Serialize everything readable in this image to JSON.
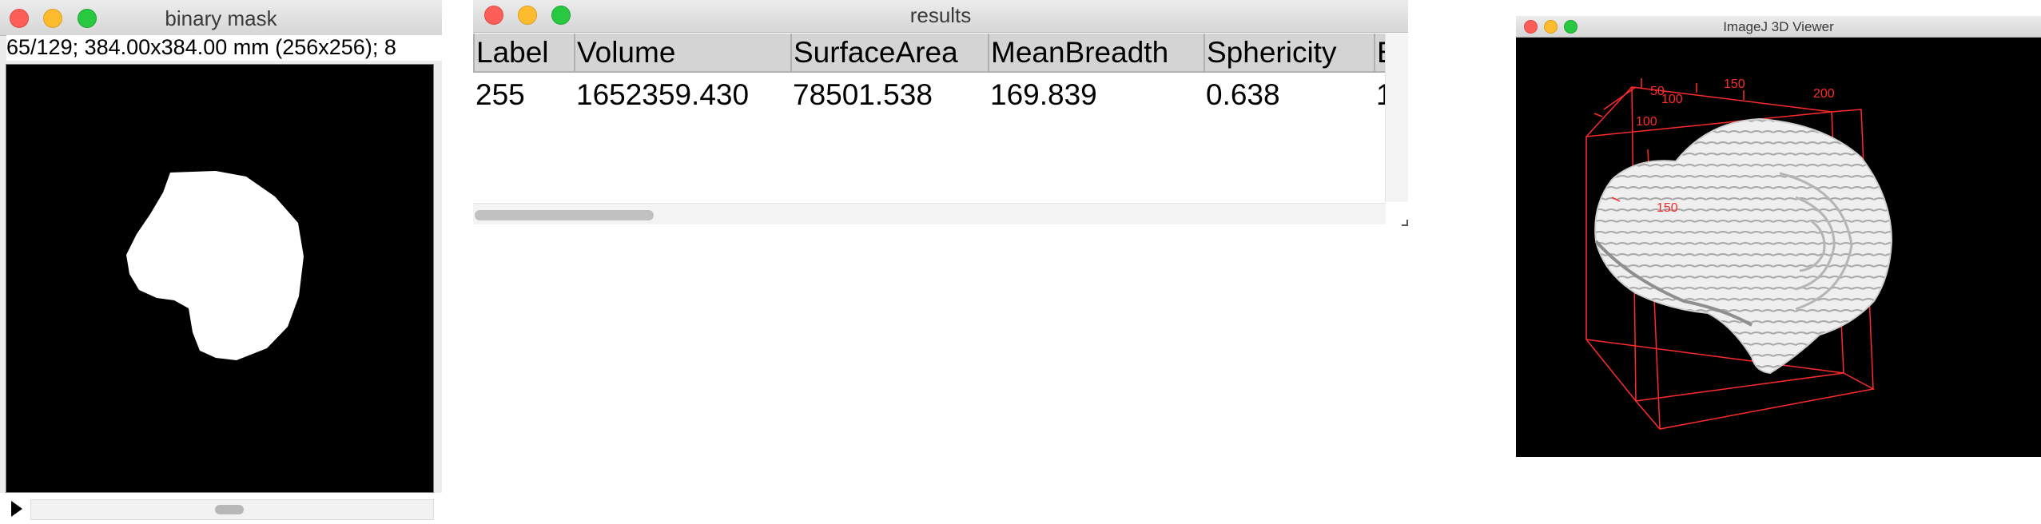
{
  "mask_window": {
    "title": "binary mask",
    "info": "65/129; 384.00x384.00 mm (256x256); 8"
  },
  "results_window": {
    "title": "results",
    "columns": [
      "Label",
      "Volume",
      "SurfaceArea",
      "MeanBreadth",
      "Sphericity",
      "E"
    ],
    "rows": [
      [
        "255",
        "1652359.430",
        "78501.538",
        "169.839",
        "0.638",
        "1"
      ]
    ]
  },
  "viewer_window": {
    "title": "ImageJ 3D Viewer",
    "tick_labels": [
      "50",
      "100",
      "150",
      "200",
      "100",
      "150"
    ]
  },
  "colors": {
    "close": "#fc5f57",
    "minimize": "#fdbc2e",
    "zoom": "#28c840",
    "bounding_box": "#ff2a2a"
  }
}
